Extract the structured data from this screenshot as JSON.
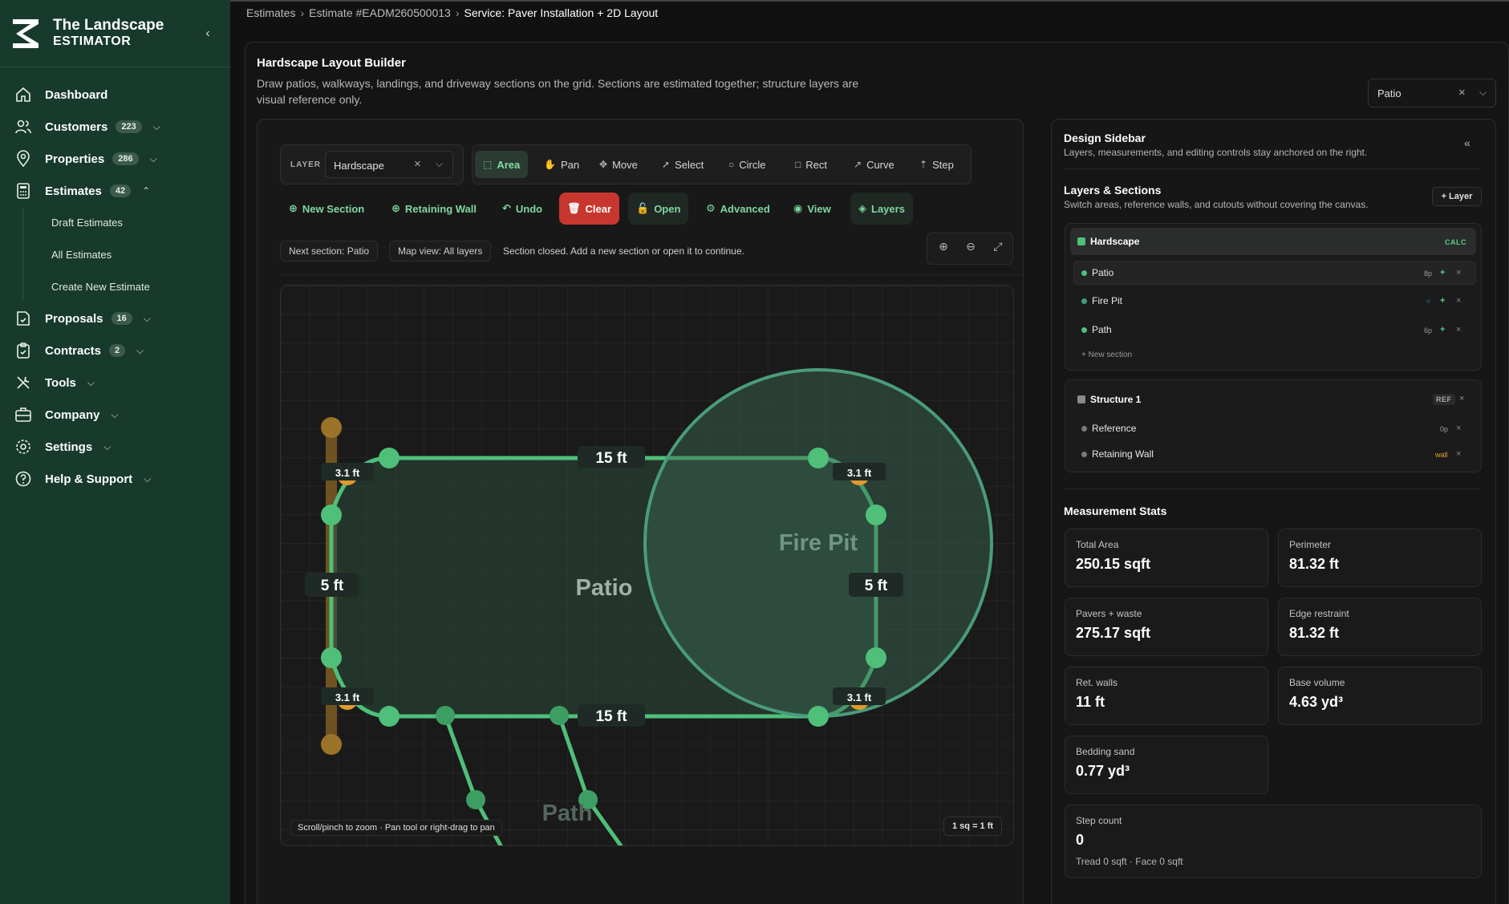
{
  "brand": {
    "title": "The Landscape",
    "subtitle": "ESTIMATOR"
  },
  "nav": {
    "dashboard": "Dashboard",
    "customers": {
      "label": "Customers",
      "badge": "223"
    },
    "properties": {
      "label": "Properties",
      "badge": "286"
    },
    "estimates": {
      "label": "Estimates",
      "badge": "42"
    },
    "sub": [
      "Draft Estimates",
      "All Estimates",
      "Create New Estimate"
    ],
    "proposals": {
      "label": "Proposals",
      "badge": "16"
    },
    "contracts": {
      "label": "Contracts",
      "badge": "2"
    },
    "tools": "Tools",
    "company": "Company",
    "settings": "Settings",
    "help": "Help & Support"
  },
  "breadcrumb": [
    "Estimates",
    "Estimate #EADM260500013",
    "Service: Paver Installation + 2D Layout"
  ],
  "builder": {
    "title": "Hardscape Layout Builder",
    "description": "Draw patios, walkways, landings, and driveway sections on the grid. Sections are estimated together; structure layers are visual reference only.",
    "section_select": "Patio"
  },
  "toolbar": {
    "layer_label": "LAYER",
    "layer_value": "Hardscape",
    "tools": [
      "Area",
      "Pan",
      "Move",
      "Select",
      "Circle",
      "Rect",
      "Curve",
      "Step"
    ],
    "active_tool": "Area"
  },
  "actions": [
    "New Section",
    "Retaining Wall",
    "Undo",
    "Clear",
    "Open",
    "Advanced",
    "View",
    "Layers"
  ],
  "status": {
    "next_section": "Next section: Patio",
    "map_view": "Map view: All layers",
    "message": "Section closed. Add a new section or open it to continue."
  },
  "canvas": {
    "labels": {
      "patio": "Patio",
      "fire_pit": "Fire Pit",
      "path": "Path"
    },
    "dims": {
      "top": "15 ft",
      "bottom": "15 ft",
      "left": "5 ft",
      "right": "5 ft",
      "corner": "3.1 ft"
    },
    "hint": "Scroll/pinch to zoom · Pan tool or right-drag to pan",
    "scale": "1 sq = 1 ft"
  },
  "design_sidebar": {
    "title": "Design Sidebar",
    "subtitle": "Layers, measurements, and editing controls stay anchored on the right.",
    "layers_title": "Layers & Sections",
    "layers_subtitle": "Switch areas, reference walls, and cutouts without covering the canvas.",
    "add_layer": "+ Layer",
    "hardscape": {
      "name": "Hardscape",
      "tag": "CALC",
      "sections": [
        {
          "name": "Patio",
          "meta": "8p"
        },
        {
          "name": "Fire Pit",
          "meta": "○"
        },
        {
          "name": "Path",
          "meta": "6p"
        }
      ],
      "new_section": "+ New section"
    },
    "structure": {
      "name": "Structure 1",
      "tag": "REF",
      "items": [
        {
          "name": "Reference",
          "meta": "0p"
        },
        {
          "name": "Retaining Wall",
          "meta": "wall"
        }
      ]
    }
  },
  "stats": {
    "title": "Measurement Stats",
    "total_area": {
      "label": "Total Area",
      "value": "250.15 sqft"
    },
    "perimeter": {
      "label": "Perimeter",
      "value": "81.32 ft"
    },
    "pavers": {
      "label": "Pavers + waste",
      "value": "275.17 sqft"
    },
    "edge": {
      "label": "Edge restraint",
      "value": "81.32 ft"
    },
    "ret_walls": {
      "label": "Ret. walls",
      "value": "11 ft"
    },
    "base_volume": {
      "label": "Base volume",
      "value": "4.63 yd³"
    },
    "bedding": {
      "label": "Bedding sand",
      "value": "0.77 yd³"
    },
    "step": {
      "label": "Step count",
      "value": "0",
      "sub": "Tread 0 sqft · Face 0 sqft"
    }
  },
  "colors": {
    "sidebar": "#173a2c",
    "accent": "#4fbf7a",
    "clear": "#c8372f",
    "wall": "#e09a2e"
  }
}
